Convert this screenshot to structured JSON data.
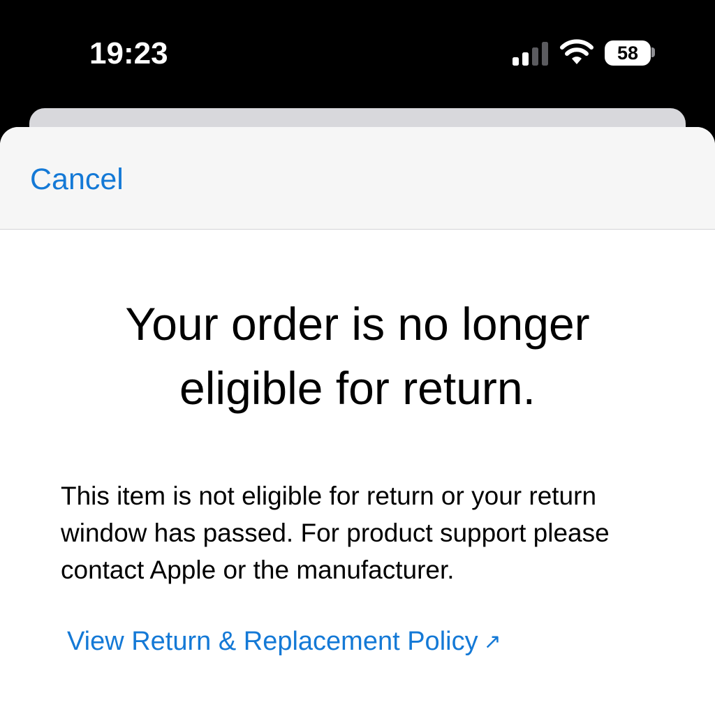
{
  "status_bar": {
    "time": "19:23",
    "battery": "58",
    "icons": [
      "cellular-signal-icon",
      "wifi-icon",
      "battery-icon"
    ]
  },
  "header": {
    "cancel_label": "Cancel"
  },
  "content": {
    "headline": "Your order is no longer eligible for return.",
    "body": "This item is not eligible for return or your return window has passed. For product support please contact Apple or the manufacturer.",
    "policy_link_label": "View Return & Replacement Policy",
    "policy_link_icon": "external-link-arrow-icon"
  },
  "colors": {
    "accent": "#1479d6",
    "header_bg": "#f6f6f6"
  }
}
